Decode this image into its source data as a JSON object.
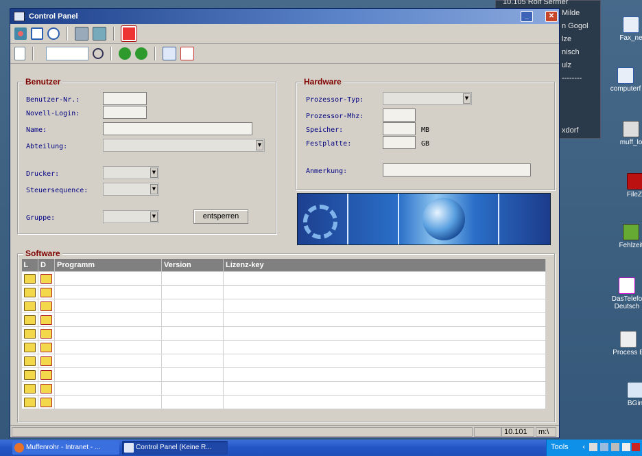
{
  "window": {
    "title": "Control Panel",
    "min_label": "_",
    "close_label": "✕"
  },
  "toolbar1": {
    "icons": [
      "users-icon",
      "window-icon",
      "help-icon",
      "computer-icon",
      "network-icon",
      "power-icon"
    ]
  },
  "toolbar2": {
    "search_value": "",
    "icons": [
      "new-document-icon",
      "search-icon",
      "back-icon",
      "forward-icon",
      "check-icon",
      "delete-icon"
    ]
  },
  "benutzer": {
    "title": "Benutzer",
    "labels": {
      "nr": "Benutzer-Nr.:",
      "novell": "Novell-Login:",
      "name": "Name:",
      "abteilung": "Abteilung:",
      "drucker": "Drucker:",
      "steuer": "Steuersequence:",
      "gruppe": "Gruppe:"
    },
    "values": {
      "nr": "",
      "novell": "",
      "name": "",
      "abteilung": "",
      "drucker": "",
      "steuer": "",
      "gruppe": ""
    },
    "unlock_button": "entsperren"
  },
  "hardware": {
    "title": "Hardware",
    "labels": {
      "proztyp": "Prozessor-Typ:",
      "mhz": "Prozessor-Mhz:",
      "speicher": "Speicher:",
      "festplatte": "Festplatte:",
      "anmerkung": "Anmerkung:"
    },
    "units": {
      "speicher": "MB",
      "festplatte": "GB"
    }
  },
  "software": {
    "title": "Software",
    "columns": [
      "L",
      "D",
      "Programm",
      "Version",
      "Lizenz-key"
    ],
    "row_count": 10
  },
  "statusbar": {
    "value": "10.101",
    "drive": "m:\\"
  },
  "taskbar": {
    "tasks": [
      "Muffenrohr - Intranet - ...",
      "Control Panel (Keine R..."
    ],
    "tools_label": "Tools"
  },
  "background_window": {
    "lines": [
      "10.105 Rolf Sermer",
      "Milde",
      "n Gogol",
      "lze",
      "nisch",
      "ulz",
      "--------",
      "",
      "xdorf"
    ]
  },
  "desktop_icons": [
    "Fax_ne",
    "computerf",
    "muff_lo",
    "FileZi",
    "Fehlzeit",
    "DasTelefo Deutsch",
    "Process E",
    "BGin"
  ],
  "colors": {
    "group_title": "#800000",
    "field_label": "#000080",
    "titlebar": "#1c3e88",
    "grid_header": "#808080"
  }
}
